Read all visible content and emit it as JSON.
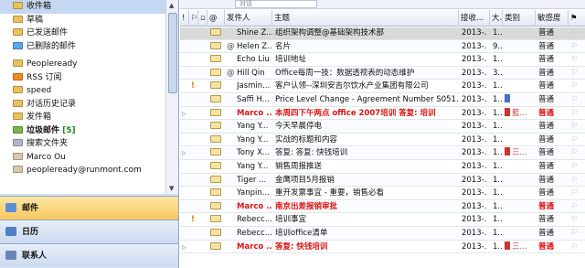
{
  "nav": {
    "folders": [
      {
        "label": "收件箱",
        "icon": "inbox-icon",
        "color": "#e8c25a",
        "level": "l1",
        "selected": true
      },
      {
        "label": "草稿",
        "icon": "drafts-icon",
        "color": "#e8c25a",
        "level": "l1"
      },
      {
        "label": "已发送邮件",
        "icon": "sent-icon",
        "color": "#e8c25a",
        "level": "l1"
      },
      {
        "label": "已删除的邮件",
        "icon": "deleted-icon",
        "color": "#5aa7e8",
        "level": "l1"
      },
      {
        "label": "gap"
      },
      {
        "label": "Peopleready",
        "icon": "folder-icon",
        "color": "#e8c25a",
        "level": "l1"
      },
      {
        "label": "RSS 订阅",
        "icon": "rss-icon",
        "color": "#f08a24",
        "level": "l1"
      },
      {
        "label": "speed",
        "icon": "folder-icon",
        "color": "#e8c25a",
        "level": "l1"
      },
      {
        "label": "对话历史记录",
        "icon": "folder-icon",
        "color": "#e8c25a",
        "level": "l1"
      },
      {
        "label": "发件箱",
        "icon": "outbox-icon",
        "color": "#e8c25a",
        "level": "l1"
      },
      {
        "label": "垃圾邮件",
        "count": "[5]",
        "icon": "junk-icon",
        "color": "#7ab648",
        "level": "l1",
        "bold": true
      },
      {
        "label": "搜索文件夹",
        "icon": "search-folder-icon",
        "color": "#b0b8c8",
        "level": "l1"
      },
      {
        "label": "Marco Ou",
        "icon": "contact-icon",
        "color": "#d8c7a8",
        "level": "l1"
      },
      {
        "label": "peopleready@runmont.com",
        "icon": "mailbox-icon",
        "color": "#d8c7a8",
        "level": "l1"
      }
    ],
    "buttons": [
      {
        "label": "邮件",
        "icon": "mail-icon",
        "color": "#5a8fd8",
        "selected": true
      },
      {
        "label": "日历",
        "icon": "calendar-icon",
        "color": "#4f7fc4"
      },
      {
        "label": "联系人",
        "icon": "contacts-icon",
        "color": "#6b86b5"
      }
    ]
  },
  "search": {
    "placeholder": "对话"
  },
  "columns": {
    "from": "发件人",
    "subject": "主题",
    "received": "接收...",
    "size": "大.",
    "category": "类别",
    "sensitivity": "敏感度"
  },
  "messages": [
    {
      "from": "Shine Z...",
      "subject": "组织架构调整@基础架构技术部",
      "date": "2013-...",
      "size": "1...",
      "sens": "普通",
      "selected": true
    },
    {
      "from": "Helen Z...",
      "subject": "名片",
      "date": "2013-...",
      "size": "9...",
      "sens": "普通",
      "attach": true
    },
    {
      "from": "Echo Liu",
      "subject": "培训地址",
      "date": "2013-...",
      "size": "1...",
      "sens": "普通"
    },
    {
      "from": "Hill Qin",
      "subject": "Office每周一技：数据透视表的动态维护",
      "date": "2013-...",
      "size": "3...",
      "sens": "普通",
      "attach": true
    },
    {
      "from": "Jasmin...",
      "subject": "客户认领--深圳安吉尔饮水产业集团有限公司",
      "date": "2013-...",
      "size": "1...",
      "sens": "普通",
      "imp": true
    },
    {
      "from": "Saffi H...",
      "subject": "Price Level Change - Agreement Number S051...",
      "date": "2013-...",
      "size": "1...",
      "sens": "普通",
      "cat": "#4a6fc4"
    },
    {
      "from": "Marco ...",
      "subject": "本周四下午两点 office 2007培训    答复: 培训",
      "date": "2013-...",
      "size": "1...",
      "sens": "普通",
      "red": true,
      "cat": "#c33",
      "catText": "藍...",
      "expand": true
    },
    {
      "from": "Yang Y...",
      "subject": "今天早晨停电",
      "date": "2013-...",
      "size": "1...",
      "sens": "普通"
    },
    {
      "from": "Yang Y...",
      "subject": "实战的标题和内容",
      "date": "2013-...",
      "size": "1...",
      "sens": "普通"
    },
    {
      "from": "Tony X...",
      "subject": "答复: 答复: 快钱培训",
      "date": "2013-...",
      "size": "1...",
      "sens": "普通",
      "cat": "#c33",
      "catText": "三...",
      "expand": true
    },
    {
      "from": "Yang Y...",
      "subject": "销售周报推送",
      "date": "2013-...",
      "size": "1...",
      "sens": "普通"
    },
    {
      "from": "Tiger ...",
      "subject": "金鹰项目5月报销",
      "date": "2013-...",
      "size": "1...",
      "sens": "普通"
    },
    {
      "from": "Yanpin...",
      "subject": "重开发票事宜 - 重要，销售必看",
      "date": "2013-...",
      "size": "1...",
      "sens": "普通"
    },
    {
      "from": "Marco ...",
      "subject": "南京出差报销审批",
      "date": "2013-...",
      "size": "1...",
      "sens": "普通",
      "red": true
    },
    {
      "from": "Rebecc...",
      "subject": "培训事宜",
      "date": "2013-...",
      "size": "1...",
      "sens": "普通",
      "imp": true
    },
    {
      "from": "Rebecc...",
      "subject": "培训office清单",
      "date": "2013-...",
      "size": "1...",
      "sens": "普通"
    },
    {
      "from": "Marco ...",
      "subject": "答复: 快钱培训",
      "date": "2013-...",
      "size": "1...",
      "sens": "普通",
      "red": true,
      "cat": "#c33",
      "catText": "三...",
      "expand": true
    }
  ]
}
